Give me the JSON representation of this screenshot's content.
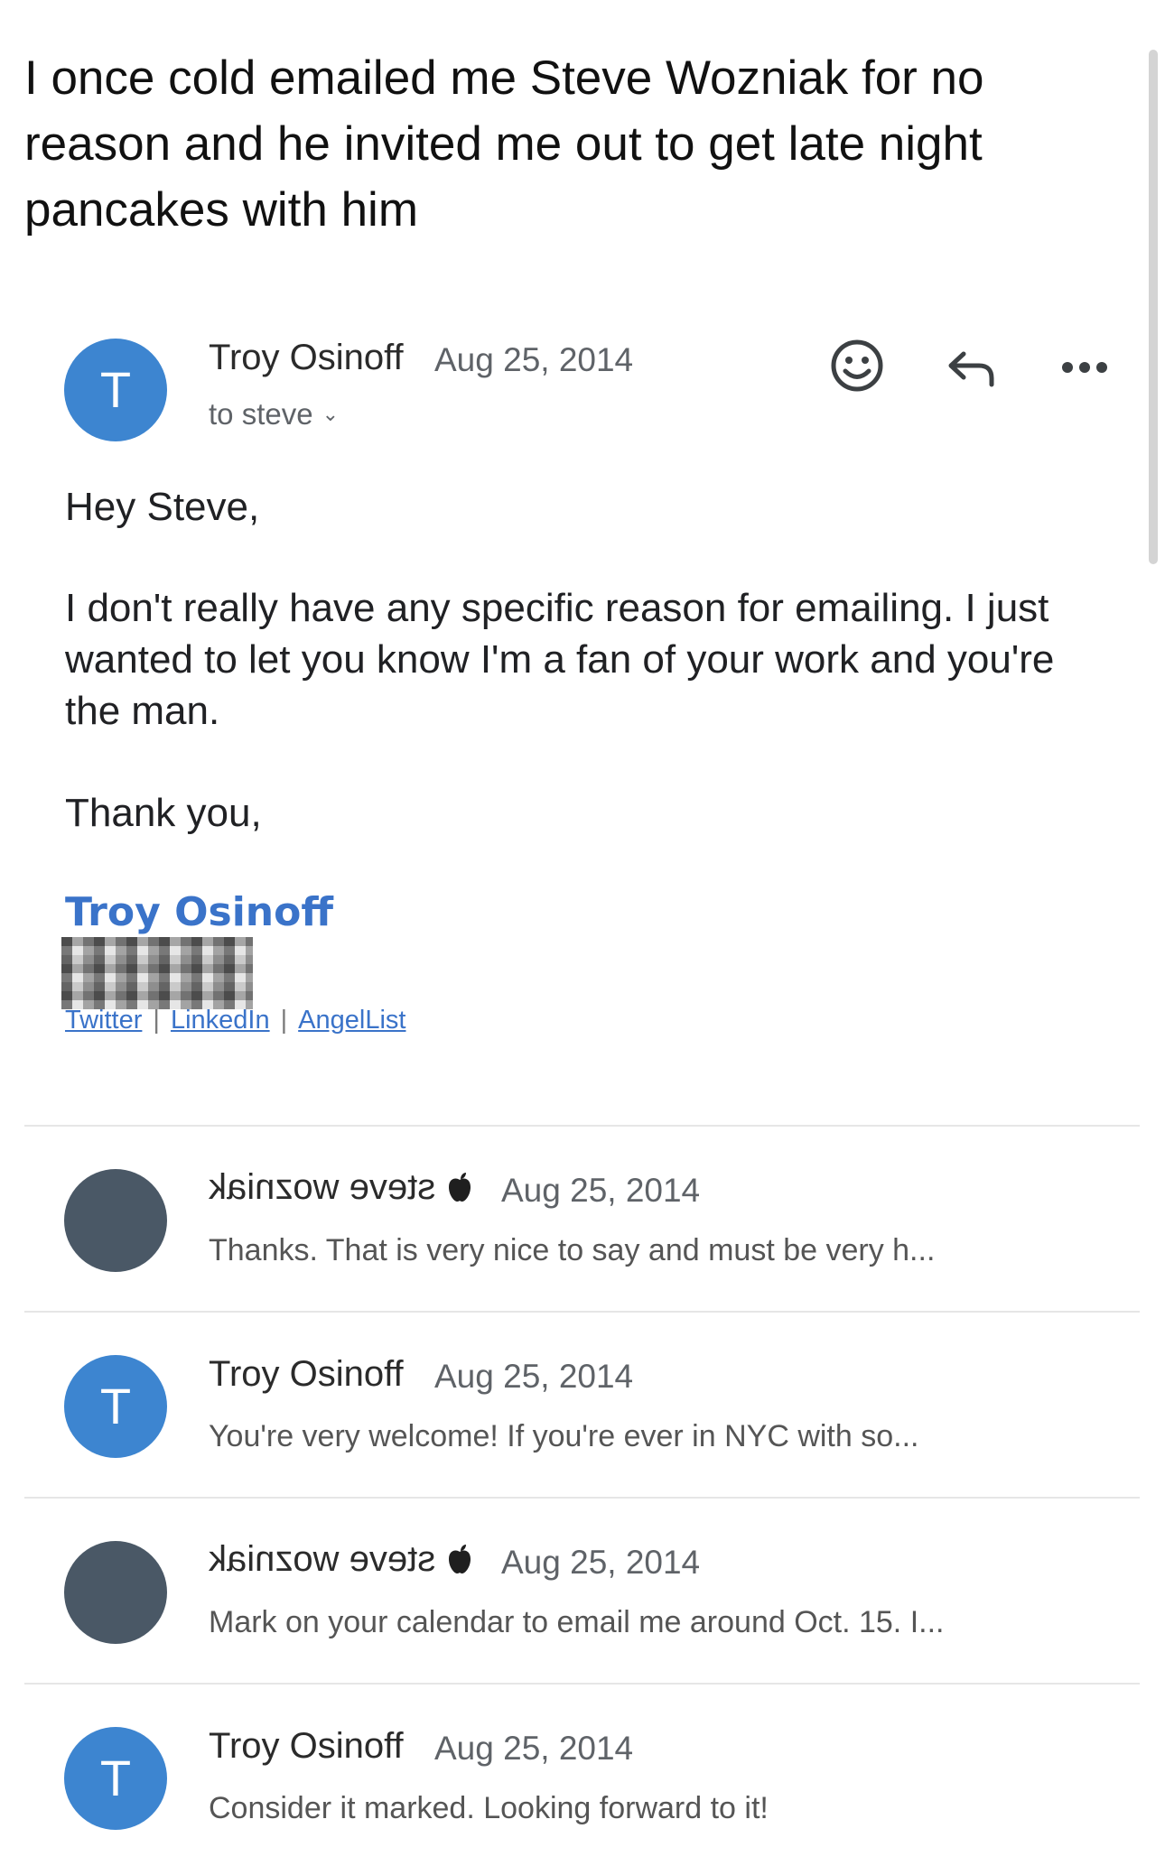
{
  "post": {
    "text": "I once cold emailed me Steve Wozniak for no reason and he invited me out to get late night pancakes with him"
  },
  "email": {
    "sender": "Troy Osinoff",
    "avatar_letter": "T",
    "date": "Aug 25, 2014",
    "to": "to steve",
    "greeting": "Hey Steve,",
    "body": "I don't really have any specific reason for emailing. I just wanted to let you know I'm a fan of your work and you're the man.",
    "closing": "Thank you,",
    "signature": {
      "name": "Troy Osinoff",
      "links": [
        "Twitter",
        "LinkedIn",
        "AngelList"
      ],
      "separator": "|"
    },
    "actions": [
      "smiley-icon",
      "reply-icon",
      "more-icon"
    ]
  },
  "thread": [
    {
      "sender": "steve wozniak",
      "sender_mirrored": true,
      "badge_icon": "apple-icon",
      "avatar_letter": "",
      "date": "Aug 25, 2014",
      "snippet": "Thanks. That is very nice to say and must be very h..."
    },
    {
      "sender": "Troy Osinoff",
      "sender_mirrored": false,
      "avatar_letter": "T",
      "date": "Aug 25, 2014",
      "snippet": "You're very welcome! If you're ever in NYC with so..."
    },
    {
      "sender": "steve wozniak",
      "sender_mirrored": true,
      "badge_icon": "apple-icon",
      "avatar_letter": "",
      "date": "Aug 25, 2014",
      "snippet": "Mark on your calendar to email me around Oct. 15. I..."
    },
    {
      "sender": "Troy Osinoff",
      "sender_mirrored": false,
      "avatar_letter": "T",
      "date": "Aug 25, 2014",
      "snippet": "Consider it marked. Looking forward to it!"
    }
  ],
  "colors": {
    "troy_avatar": "#3d85d0",
    "steve_avatar": "#4a5866",
    "link": "#3a73c9"
  }
}
